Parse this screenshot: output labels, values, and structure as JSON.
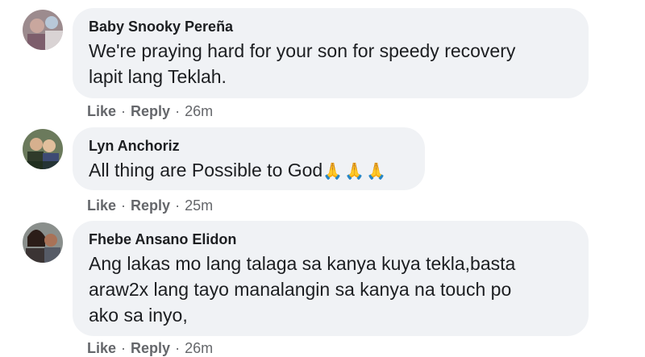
{
  "comments": [
    {
      "author": "Baby Snooky Pereña",
      "text_lines": [
        "We're praying hard for your son for speedy recovery",
        "lapit lang Teklah."
      ],
      "emoji": "",
      "like_label": "Like",
      "reply_label": "Reply",
      "time": "26m"
    },
    {
      "author": "Lyn Anchoriz",
      "text_lines": [
        "All thing are Possible to God"
      ],
      "emoji": "🙏🙏🙏",
      "like_label": "Like",
      "reply_label": "Reply",
      "time": "25m"
    },
    {
      "author": "Fhebe Ansano Elidon",
      "text_lines": [
        "Ang lakas mo lang talaga sa kanya kuya tekla,basta",
        "araw2x lang tayo manalangin sa kanya na touch po",
        "ako sa inyo,"
      ],
      "emoji": "",
      "like_label": "Like",
      "reply_label": "Reply",
      "time": "26m"
    }
  ],
  "colors": {
    "bubble": "#f0f2f5",
    "text": "#1c1e21",
    "meta": "#65676b",
    "emoji": "#e4a93b"
  }
}
